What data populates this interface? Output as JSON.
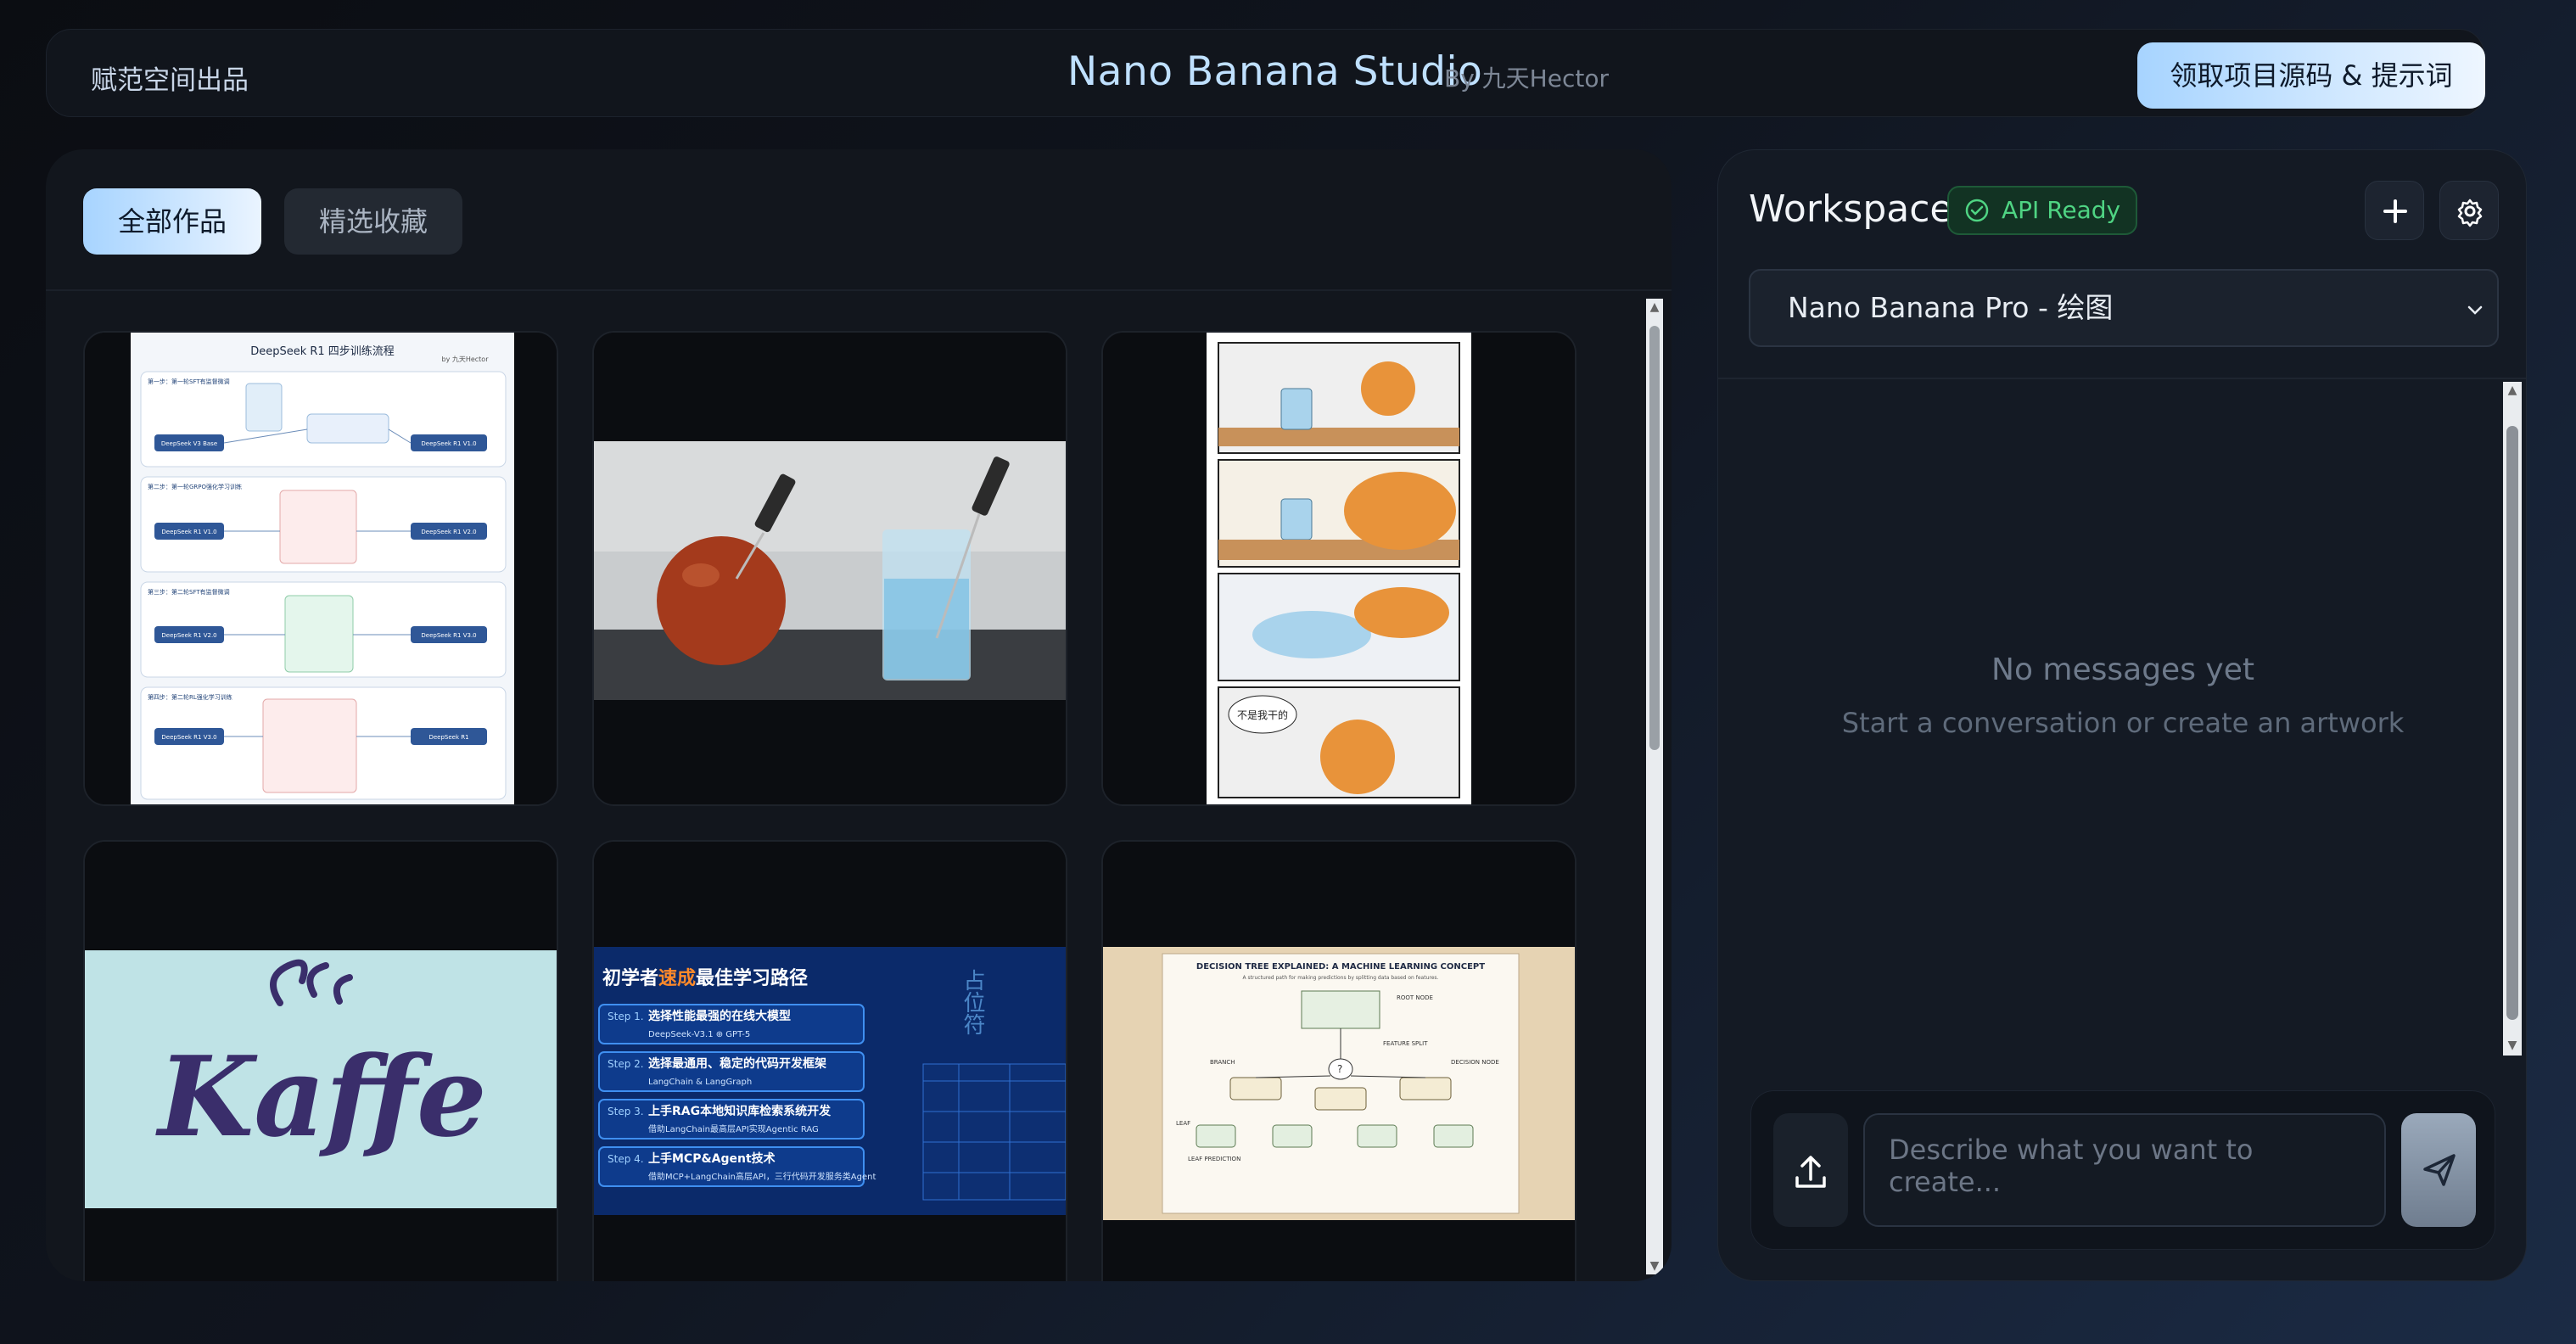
{
  "header": {
    "left_label": "赋范空间出品",
    "title": "Nano Banana Studio",
    "byline": "By 九天Hector",
    "cta_label": "领取项目源码 & 提示词"
  },
  "gallery": {
    "tabs": [
      {
        "label": "全部作品",
        "active": true
      },
      {
        "label": "精选收藏",
        "active": false
      }
    ],
    "cards": [
      {
        "name": "deepseek-r1-diagram",
        "title": "DeepSeek R1 四步训练流程",
        "byline": "by 九天Hector",
        "steps": [
          "第一步：第一轮SFT有监督微调",
          "第二步：第一轮GRPO强化学习训练",
          "第三步：第二轮SFT有监督微调",
          "第四步：第二轮RL强化学习训练"
        ],
        "boxes": [
          "DeepSeek V3 Base",
          "DeepSeek R1 V1.0",
          "DeepSeek R1 V2.0",
          "DeepSeek R1 V3.0",
          "DeepSeek R1"
        ]
      },
      {
        "name": "thermometer-photo"
      },
      {
        "name": "cat-comic",
        "speech": "不是我干的"
      },
      {
        "name": "kaffe-logo",
        "text": "Kaffe"
      },
      {
        "name": "learning-path",
        "title_pre": "初学者",
        "title_hl": "速成",
        "title_post": "最佳学习路径",
        "placeholder": "占位符",
        "steps": [
          {
            "label": "Step 1.",
            "text": "选择性能最强的在线大模型",
            "sub": "DeepSeek-V3.1 ⊕ GPT-5"
          },
          {
            "label": "Step 2.",
            "text": "选择最通用、稳定的代码开发框架",
            "sub": "LangChain & LangGraph"
          },
          {
            "label": "Step 3.",
            "text": "上手RAG本地知识库检索系统开发",
            "sub": "借助LangChain最高层API实现Agentic RAG"
          },
          {
            "label": "Step 4.",
            "text": "上手MCP&Agent技术",
            "sub": "借助MCP+LangChain高层API，三行代码开发服务类Agent"
          }
        ]
      },
      {
        "name": "decision-tree-poster",
        "title": "DECISION TREE EXPLAINED: A MACHINE LEARNING CONCEPT",
        "subtitle": "A structured path for making predictions by splitting data based on features.",
        "labels": [
          "ROOT NODE",
          "BRANCH",
          "DECISION NODE",
          "LEAF",
          "LEAF PREDICTION",
          "FEATURE SPLIT"
        ]
      }
    ]
  },
  "workspace": {
    "title": "Workspace",
    "api_status": "API Ready",
    "model_selected": "Nano Banana Pro - 绘图",
    "empty_title": "No messages yet",
    "empty_subtitle": "Start a conversation or create an artwork",
    "prompt_placeholder": "Describe what you want to create..."
  },
  "colors": {
    "accent": "#a7d4ff",
    "status_green": "#4fd483",
    "background": "#0b0d12"
  },
  "icons": [
    "plus-icon",
    "gear-icon",
    "chevron-down-icon",
    "upload-icon",
    "send-icon",
    "check-circle-icon"
  ]
}
